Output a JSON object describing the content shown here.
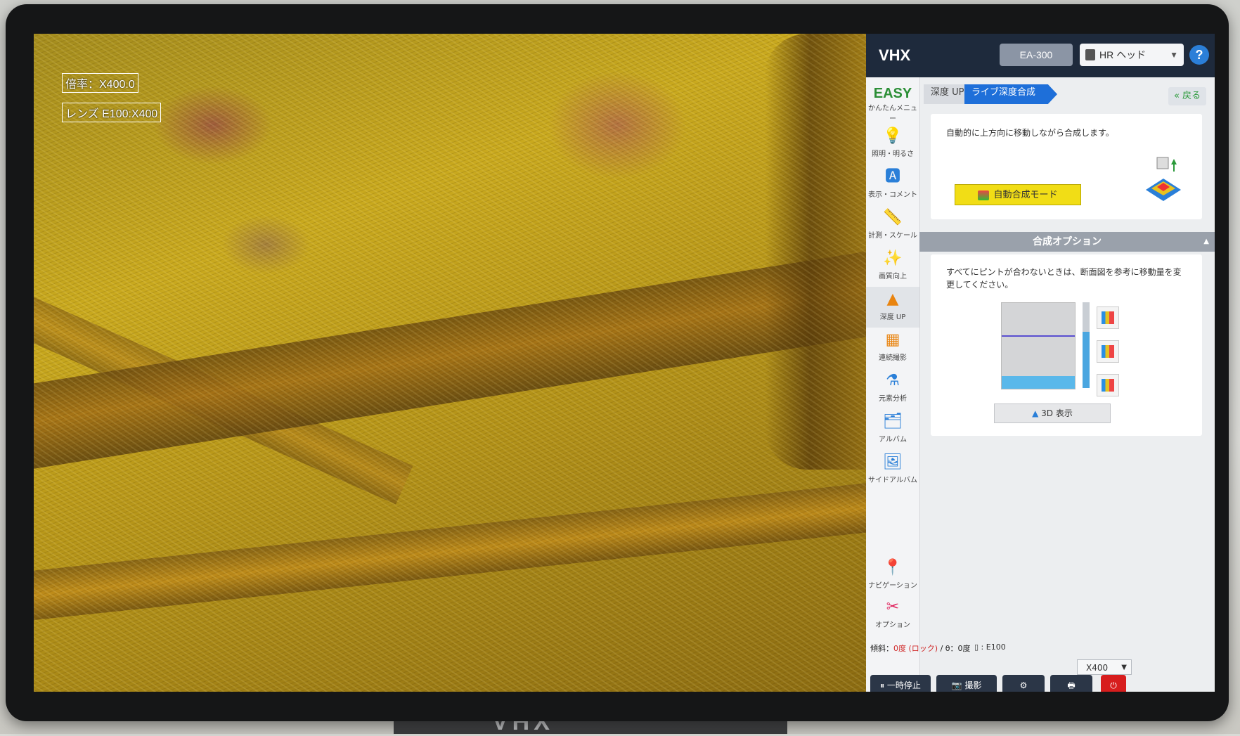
{
  "overlay": {
    "magnification": "倍率：X400.0",
    "lens": "レンズ E100:X400"
  },
  "header": {
    "logo": "VHX",
    "ea_button": "EA-300",
    "head_select": "HR ヘッド",
    "help": "?"
  },
  "sidebar": {
    "items": [
      {
        "icon": "easy",
        "label": "かんたんメニュー",
        "title": "EASY"
      },
      {
        "icon": "bulb-icon",
        "label": "照明・明るさ"
      },
      {
        "icon": "display-comment-icon",
        "label": "表示・コメント"
      },
      {
        "icon": "ruler-icon",
        "label": "計測・スケール"
      },
      {
        "icon": "wand-icon",
        "label": "画質向上"
      },
      {
        "icon": "depth-up-icon",
        "label": "深度 UP"
      },
      {
        "icon": "stitch-icon",
        "label": "連続撮影"
      },
      {
        "icon": "element-analysis-icon",
        "label": "元素分析"
      },
      {
        "icon": "album-icon",
        "label": "アルバム"
      },
      {
        "icon": "side-album-icon",
        "label": "サイドアルバム"
      },
      {
        "icon": "navigation-icon",
        "label": "ナビゲーション"
      },
      {
        "icon": "options-icon",
        "label": "オプション"
      }
    ]
  },
  "main": {
    "tabs": [
      "深度 UP",
      "ライブ深度合成"
    ],
    "back": "戻る",
    "auto_desc": "自動的に上方向に移動しながら合成します。",
    "auto_button": "自動合成モード",
    "section_title": "合成オプション",
    "options_desc": "すべてにピントが合わないときは、断面図を参考に移動量を変更してください。",
    "view3d_button": "3D 表示"
  },
  "status": {
    "tilt_label": "傾斜：",
    "tilt_value": "0度 (ロック)",
    "theta": "/ θ：0度",
    "lens_value": "E100"
  },
  "zoom": "X400",
  "bottom": {
    "pause": "一時停止",
    "shoot": "撮影"
  },
  "bezel_brand": "VHX",
  "colors": {
    "accent": "#1e6fd9",
    "easy_green": "#2c8f37",
    "auto_yellow": "#f1dd16",
    "power_red": "#d71d1d"
  }
}
